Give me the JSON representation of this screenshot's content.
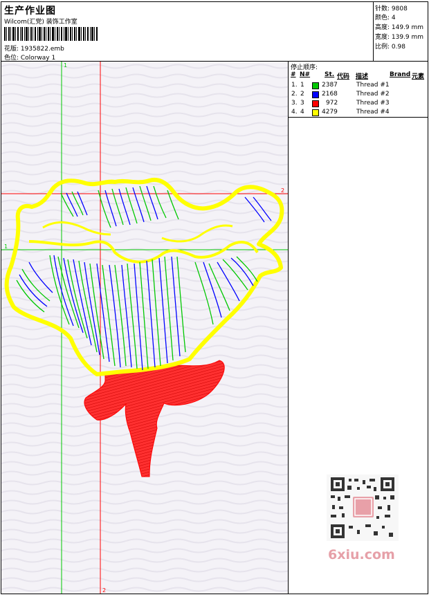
{
  "header": {
    "title": "生产作业图",
    "company": "Wilcom(汇党) 装饰工作室",
    "design_label": "花版: 1935822.emb",
    "colorway_label": "色位:  Colorway 1"
  },
  "stats": {
    "stitches": "针数:  9808",
    "colors": "颜色:  4",
    "height": "高度:  149.9 mm",
    "width": "宽度:  139.9 mm",
    "scale": "比例:  0.98"
  },
  "legend": {
    "heading": "停止顺序:",
    "col_hash": "#",
    "col_no": "N#",
    "col_st": "St.",
    "col_code": "代码",
    "col_desc": "描述",
    "col_brand": "Brand",
    "col_element": "元素",
    "rows": [
      {
        "idx": "1.",
        "no": "1",
        "st": "2387",
        "desc": "Thread #1",
        "color": "#00c800"
      },
      {
        "idx": "2.",
        "no": "2",
        "st": "2168",
        "desc": "Thread #2",
        "color": "#0000ff"
      },
      {
        "idx": "3.",
        "no": "3",
        "st": "972",
        "desc": "Thread #3",
        "color": "#ff0000"
      },
      {
        "idx": "4.",
        "no": "4",
        "st": "4279",
        "desc": "Thread #4",
        "color": "#ffff00"
      }
    ]
  },
  "guides": {
    "v1_label": "1",
    "v2_label": "2",
    "h1_label": "1",
    "h2_label": "2",
    "green": "#00c800",
    "red": "#ff0000"
  },
  "watermark": "6xiu.com"
}
